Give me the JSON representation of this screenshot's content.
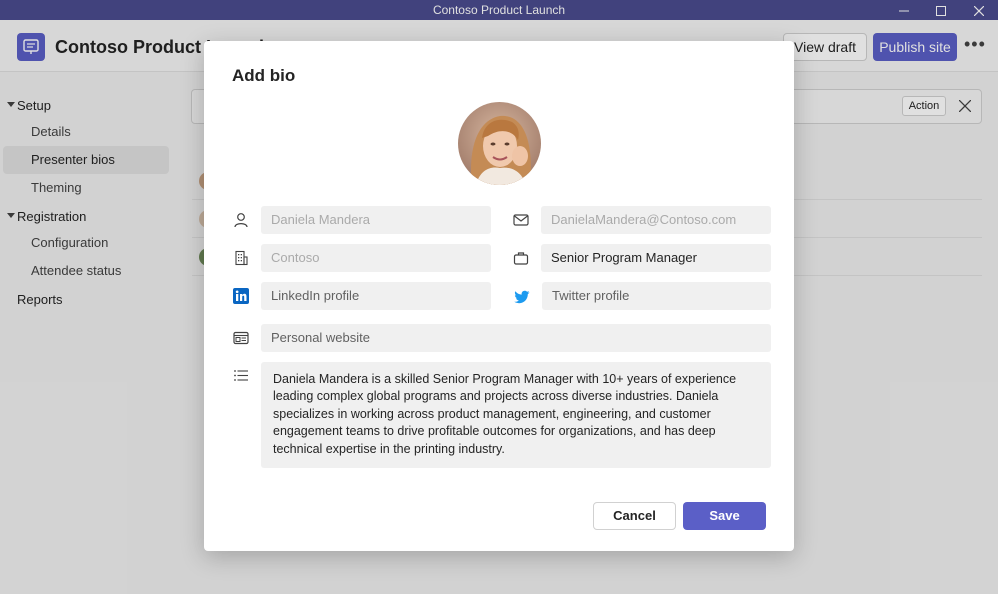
{
  "window": {
    "title": "Contoso Product Launch"
  },
  "header": {
    "title": "Contoso Product Launch",
    "view_draft": "View draft",
    "publish_site": "Publish site",
    "more": "•••"
  },
  "sidebar": {
    "groups": [
      {
        "label": "Setup",
        "items": [
          "Details",
          "Presenter bios",
          "Theming"
        ]
      },
      {
        "label": "Registration",
        "items": [
          "Configuration",
          "Attendee status"
        ]
      }
    ],
    "reports": "Reports",
    "active_item": "Presenter bios"
  },
  "background": {
    "action_label": "Action"
  },
  "dialog": {
    "title": "Add bio",
    "name": "Daniela Mandera",
    "email": "DanielaMandera@Contoso.com",
    "company": "Contoso",
    "job_title": "Senior Program Manager",
    "linkedin_placeholder": "LinkedIn profile",
    "twitter_placeholder": "Twitter profile",
    "website_placeholder": "Personal website",
    "bio": "Daniela Mandera is a skilled Senior Program Manager with 10+ years of experience leading complex global programs and projects across diverse industries. Daniela specializes in working across product management, engineering, and customer engagement teams to drive profitable outcomes for organizations, and has deep technical expertise in the printing industry.",
    "cancel": "Cancel",
    "save": "Save"
  },
  "colors": {
    "accent": "#5b5fc7",
    "titlebar": "#4b4c8f",
    "linkedin": "#0a66c2",
    "twitter": "#1d9bf0"
  }
}
